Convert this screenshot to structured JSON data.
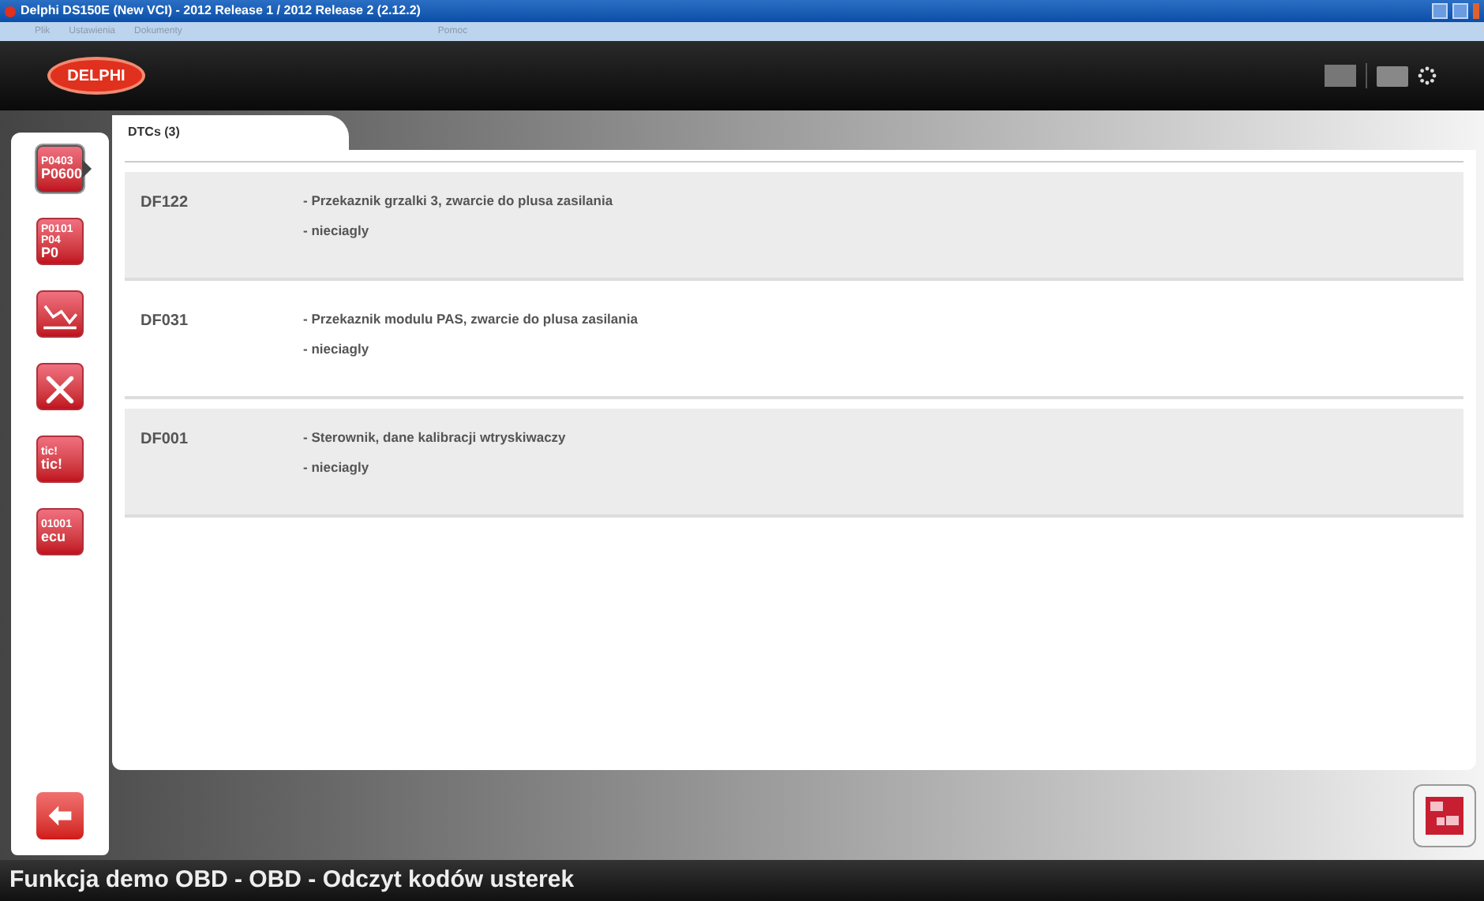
{
  "window": {
    "title": "Delphi DS150E (New VCI) - 2012 Release 1 / 2012 Release 2 (2.12.2)"
  },
  "menu": [
    "Plik",
    "Ustawienia",
    "Dokumenty",
    "Pomoc"
  ],
  "logo": "DELPHI",
  "sidebar": [
    {
      "kind": "codes",
      "lines": [
        "P0403",
        "P0600"
      ],
      "selected": true
    },
    {
      "kind": "edit",
      "lines": [
        "P0101",
        "P04",
        "P0"
      ],
      "selected": false
    },
    {
      "kind": "graph",
      "selected": false
    },
    {
      "kind": "tools",
      "selected": false
    },
    {
      "kind": "text",
      "lines": [
        "tic!",
        "tic!"
      ],
      "selected": false
    },
    {
      "kind": "ecu",
      "lines": [
        "01001",
        "ecu"
      ],
      "selected": false
    }
  ],
  "tab": {
    "label": "DTCs (3)"
  },
  "dtcs": [
    {
      "code": "DF122",
      "lines": [
        "- Przekaznik grzalki 3, zwarcie do plusa zasilania",
        "- nieciagly"
      ]
    },
    {
      "code": "DF031",
      "lines": [
        "- Przekaznik modulu PAS, zwarcie do plusa zasilania",
        "- nieciagly"
      ]
    },
    {
      "code": "DF001",
      "lines": [
        "- Sterownik, dane kalibracji wtryskiwaczy",
        "- nieciagly"
      ]
    }
  ],
  "status_bar": "Funkcja demo OBD - OBD - Odczyt kodów usterek"
}
